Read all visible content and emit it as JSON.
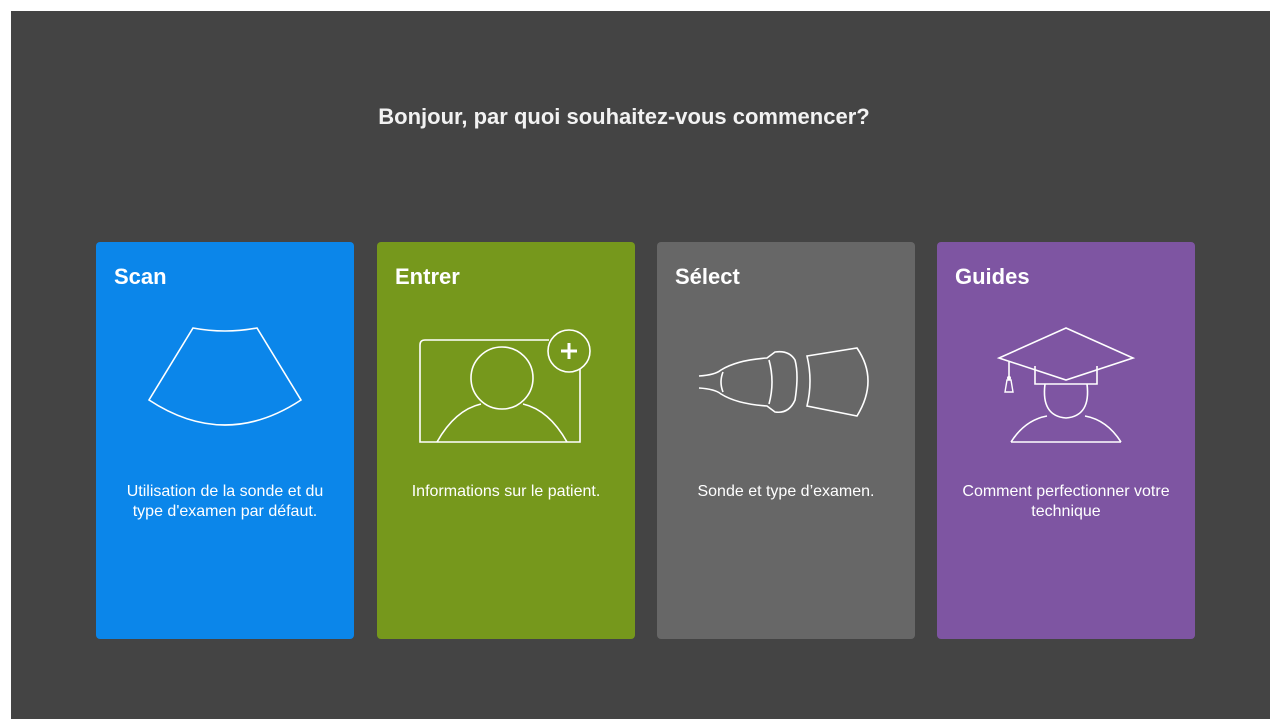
{
  "heading": "Bonjour, par quoi souhaitez-vous commencer?",
  "cards": [
    {
      "title": "Scan",
      "description": "Utilisation de la sonde et du type d'examen par défaut.",
      "color": "#0b86ea",
      "icon": "ultrasound-fan-icon"
    },
    {
      "title": "Entrer",
      "description": "Informations sur le patient.",
      "color": "#76981c",
      "icon": "add-patient-icon"
    },
    {
      "title": "Sélect",
      "description": "Sonde et type d’examen.",
      "color": "#676767",
      "icon": "probe-icon"
    },
    {
      "title": "Guides",
      "description": "Comment perfectionner votre technique",
      "color": "#7e55a2",
      "icon": "graduation-cap-icon"
    }
  ]
}
